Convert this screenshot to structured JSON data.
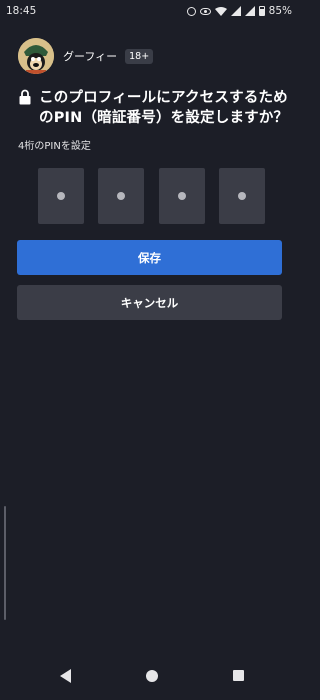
{
  "status_bar": {
    "time": "18:45",
    "battery": "85%",
    "icons": [
      "alarm-icon",
      "eye-icon",
      "wifi-icon",
      "signal-icon",
      "signal-icon",
      "battery-icon"
    ]
  },
  "profile": {
    "name": "グーフィー",
    "age_badge": "18+",
    "avatar_icon": "goofy-avatar"
  },
  "question": {
    "icon": "lock-icon",
    "text": "このプロフィールにアクセスするためのPIN（暗証番号）を設定しますか？"
  },
  "pin": {
    "hint": "4桁のPINを設定",
    "digits": 4
  },
  "buttons": {
    "save": "保存",
    "cancel": "キャンセル"
  },
  "colors": {
    "background": "#1c1e27",
    "primary": "#2f6fd6",
    "secondary": "#3b3d47"
  },
  "nav_bar": {
    "icons": [
      "back-icon",
      "home-icon",
      "recents-icon"
    ]
  }
}
